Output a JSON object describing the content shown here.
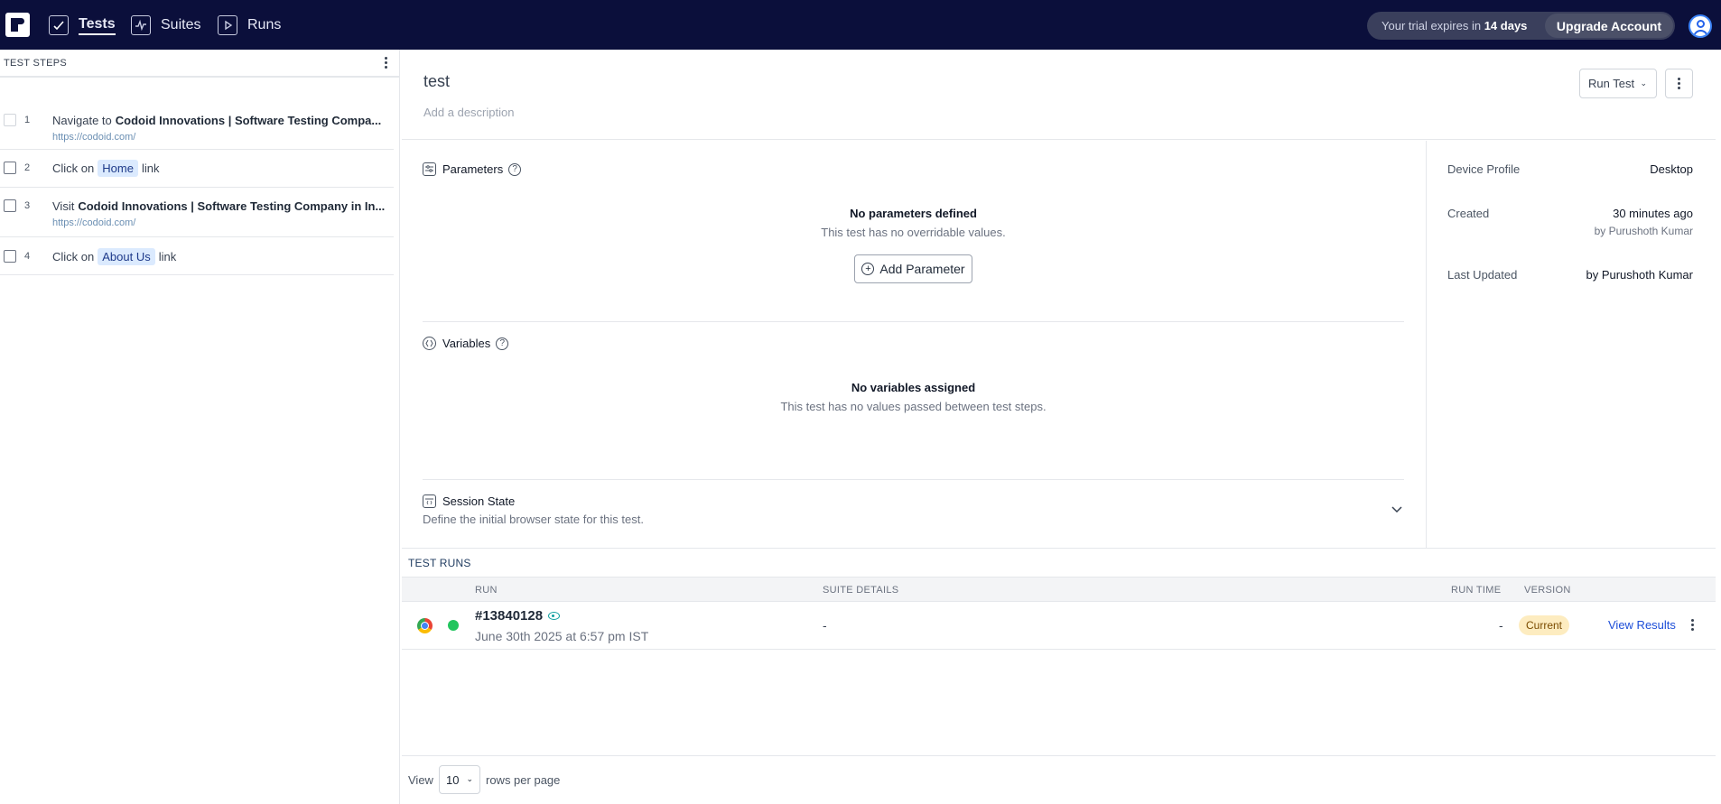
{
  "nav": {
    "tabs": [
      {
        "label": "Tests"
      },
      {
        "label": "Suites"
      },
      {
        "label": "Runs"
      }
    ],
    "trial_prefix": "Your trial expires in",
    "trial_days": "14 days",
    "upgrade_label": "Upgrade Account"
  },
  "steps_panel": {
    "title": "TEST STEPS",
    "steps": [
      {
        "num": "1",
        "action": "Navigate to",
        "target": "Codoid Innovations | Software Testing Compa...",
        "url": "https://codoid.com/"
      },
      {
        "num": "2",
        "action": "Click on",
        "chip": "Home",
        "suffix": "link"
      },
      {
        "num": "3",
        "action": "Visit",
        "target": "Codoid Innovations | Software Testing Company in In...",
        "url": "https://codoid.com/"
      },
      {
        "num": "4",
        "action": "Click on",
        "chip": "About Us",
        "suffix": "link"
      }
    ]
  },
  "test": {
    "title": "test",
    "description_placeholder": "Add a description",
    "run_label": "Run Test"
  },
  "parameters": {
    "title": "Parameters",
    "empty_title": "No parameters defined",
    "empty_sub": "This test has no overridable values.",
    "add_label": "Add Parameter"
  },
  "variables": {
    "title": "Variables",
    "empty_title": "No variables assigned",
    "empty_sub": "This test has no values passed between test steps."
  },
  "session": {
    "title": "Session State",
    "sub": "Define the initial browser state for this test."
  },
  "meta": {
    "device_label": "Device Profile",
    "device_value": "Desktop",
    "created_label": "Created",
    "created_value": "30 minutes ago",
    "created_by": "by Purushoth Kumar",
    "updated_label": "Last Updated",
    "updated_by": "by Purushoth Kumar"
  },
  "runs": {
    "title": "TEST RUNS",
    "columns": {
      "run": "RUN",
      "suite": "SUITE DETAILS",
      "run_time": "RUN TIME",
      "version": "VERSION"
    },
    "rows": [
      {
        "id": "#13840128",
        "date": "June 30th 2025 at 6:57 pm IST",
        "suite": "-",
        "run_time": "-",
        "version": "Current",
        "action": "View Results"
      }
    ]
  },
  "footer": {
    "view_label": "View",
    "rows_value": "10",
    "rows_label": "rows per page"
  },
  "colors": {
    "nav_bg": "#0b0f3b",
    "chip_bg": "#dbeafe",
    "status_ok": "#22c55e",
    "badge_bg": "#fdecc0",
    "link": "#1d4ed8"
  }
}
